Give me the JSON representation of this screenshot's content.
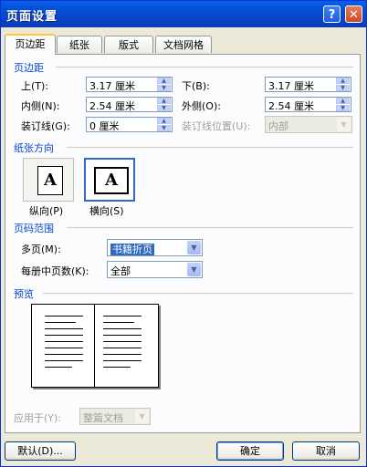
{
  "window": {
    "title": "页面设置",
    "help_label": "?",
    "close_label": "✕"
  },
  "tabs": [
    {
      "label": "页边距"
    },
    {
      "label": "纸张"
    },
    {
      "label": "版式"
    },
    {
      "label": "文档网格"
    }
  ],
  "margins": {
    "group_label": "页边距",
    "top_label": "上(T):",
    "top_value": "3.17 厘米",
    "bottom_label": "下(B):",
    "bottom_value": "3.17 厘米",
    "inside_label": "内侧(N):",
    "inside_value": "2.54 厘米",
    "outside_label": "外侧(O):",
    "outside_value": "2.54 厘米",
    "gutter_label": "装订线(G):",
    "gutter_value": "0 厘米",
    "gutter_pos_label": "装订线位置(U):",
    "gutter_pos_value": "内部"
  },
  "orientation": {
    "group_label": "纸张方向",
    "portrait_label": "纵向(P)",
    "landscape_label": "横向(S)",
    "icon_letter": "A"
  },
  "pages": {
    "group_label": "页码范围",
    "multiple_label": "多页(M):",
    "multiple_value": "书籍折页",
    "sheets_label": "每册中页数(K):",
    "sheets_value": "全部"
  },
  "preview": {
    "group_label": "预览"
  },
  "apply": {
    "label": "应用于(Y):",
    "value": "整篇文档"
  },
  "buttons": {
    "default_label": "默认(D)...",
    "ok_label": "确定",
    "cancel_label": "取消"
  }
}
